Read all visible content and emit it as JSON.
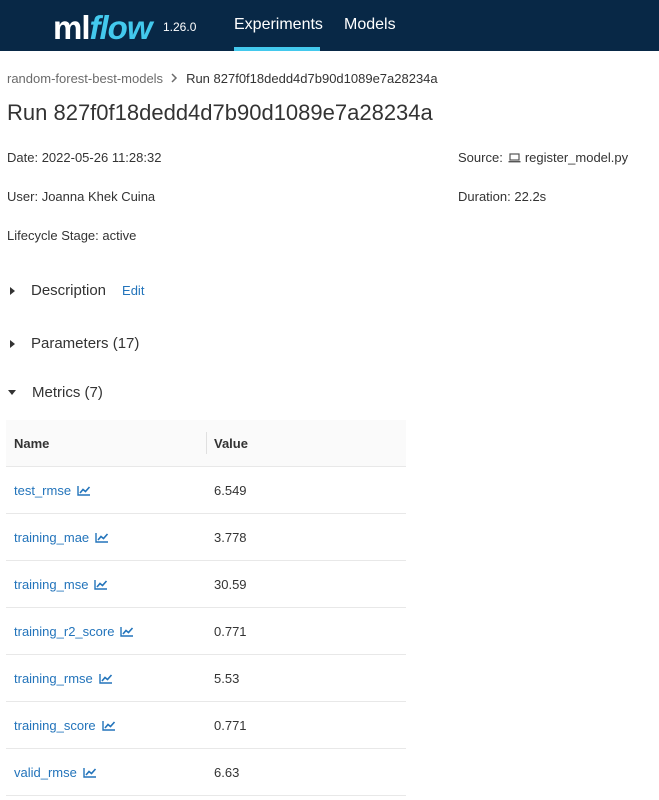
{
  "header": {
    "logo_ml": "ml",
    "logo_flow": "flow",
    "version": "1.26.0",
    "tabs": [
      {
        "label": "Experiments",
        "active": true
      },
      {
        "label": "Models",
        "active": false
      }
    ],
    "accent_color": "#43c9ed",
    "background_color": "#082846"
  },
  "breadcrumb": {
    "experiment": "random-forest-best-models",
    "separator_icon": "chevron-right-icon",
    "current": "Run 827f0f18dedd4d7b90d1089e7a28234a"
  },
  "page_title": "Run 827f0f18dedd4d7b90d1089e7a28234a",
  "run_meta": {
    "date_label": "Date:",
    "date_value": "2022-05-26 11:28:32",
    "source_label": "Source:",
    "source_icon": "laptop-icon",
    "source_value": "register_model.py",
    "user_label": "User:",
    "user_value": "Joanna Khek Cuina",
    "duration_label": "Duration:",
    "duration_value": "22.2s",
    "lifecycle_label": "Lifecycle Stage:",
    "lifecycle_value": "active"
  },
  "sections": {
    "description": {
      "label": "Description",
      "edit_label": "Edit",
      "expanded": false
    },
    "parameters": {
      "label": "Parameters (17)",
      "expanded": false
    },
    "metrics": {
      "label": "Metrics (7)",
      "expanded": true
    }
  },
  "metrics_table": {
    "headers": {
      "name": "Name",
      "value": "Value"
    },
    "rows": [
      {
        "name": "test_rmse",
        "value": "6.549"
      },
      {
        "name": "training_mae",
        "value": "3.778"
      },
      {
        "name": "training_mse",
        "value": "30.59"
      },
      {
        "name": "training_r2_score",
        "value": "0.771"
      },
      {
        "name": "training_rmse",
        "value": "5.53"
      },
      {
        "name": "training_score",
        "value": "0.771"
      },
      {
        "name": "valid_rmse",
        "value": "6.63"
      }
    ],
    "row_icon": "line-chart-icon",
    "link_color": "#2374bb"
  }
}
